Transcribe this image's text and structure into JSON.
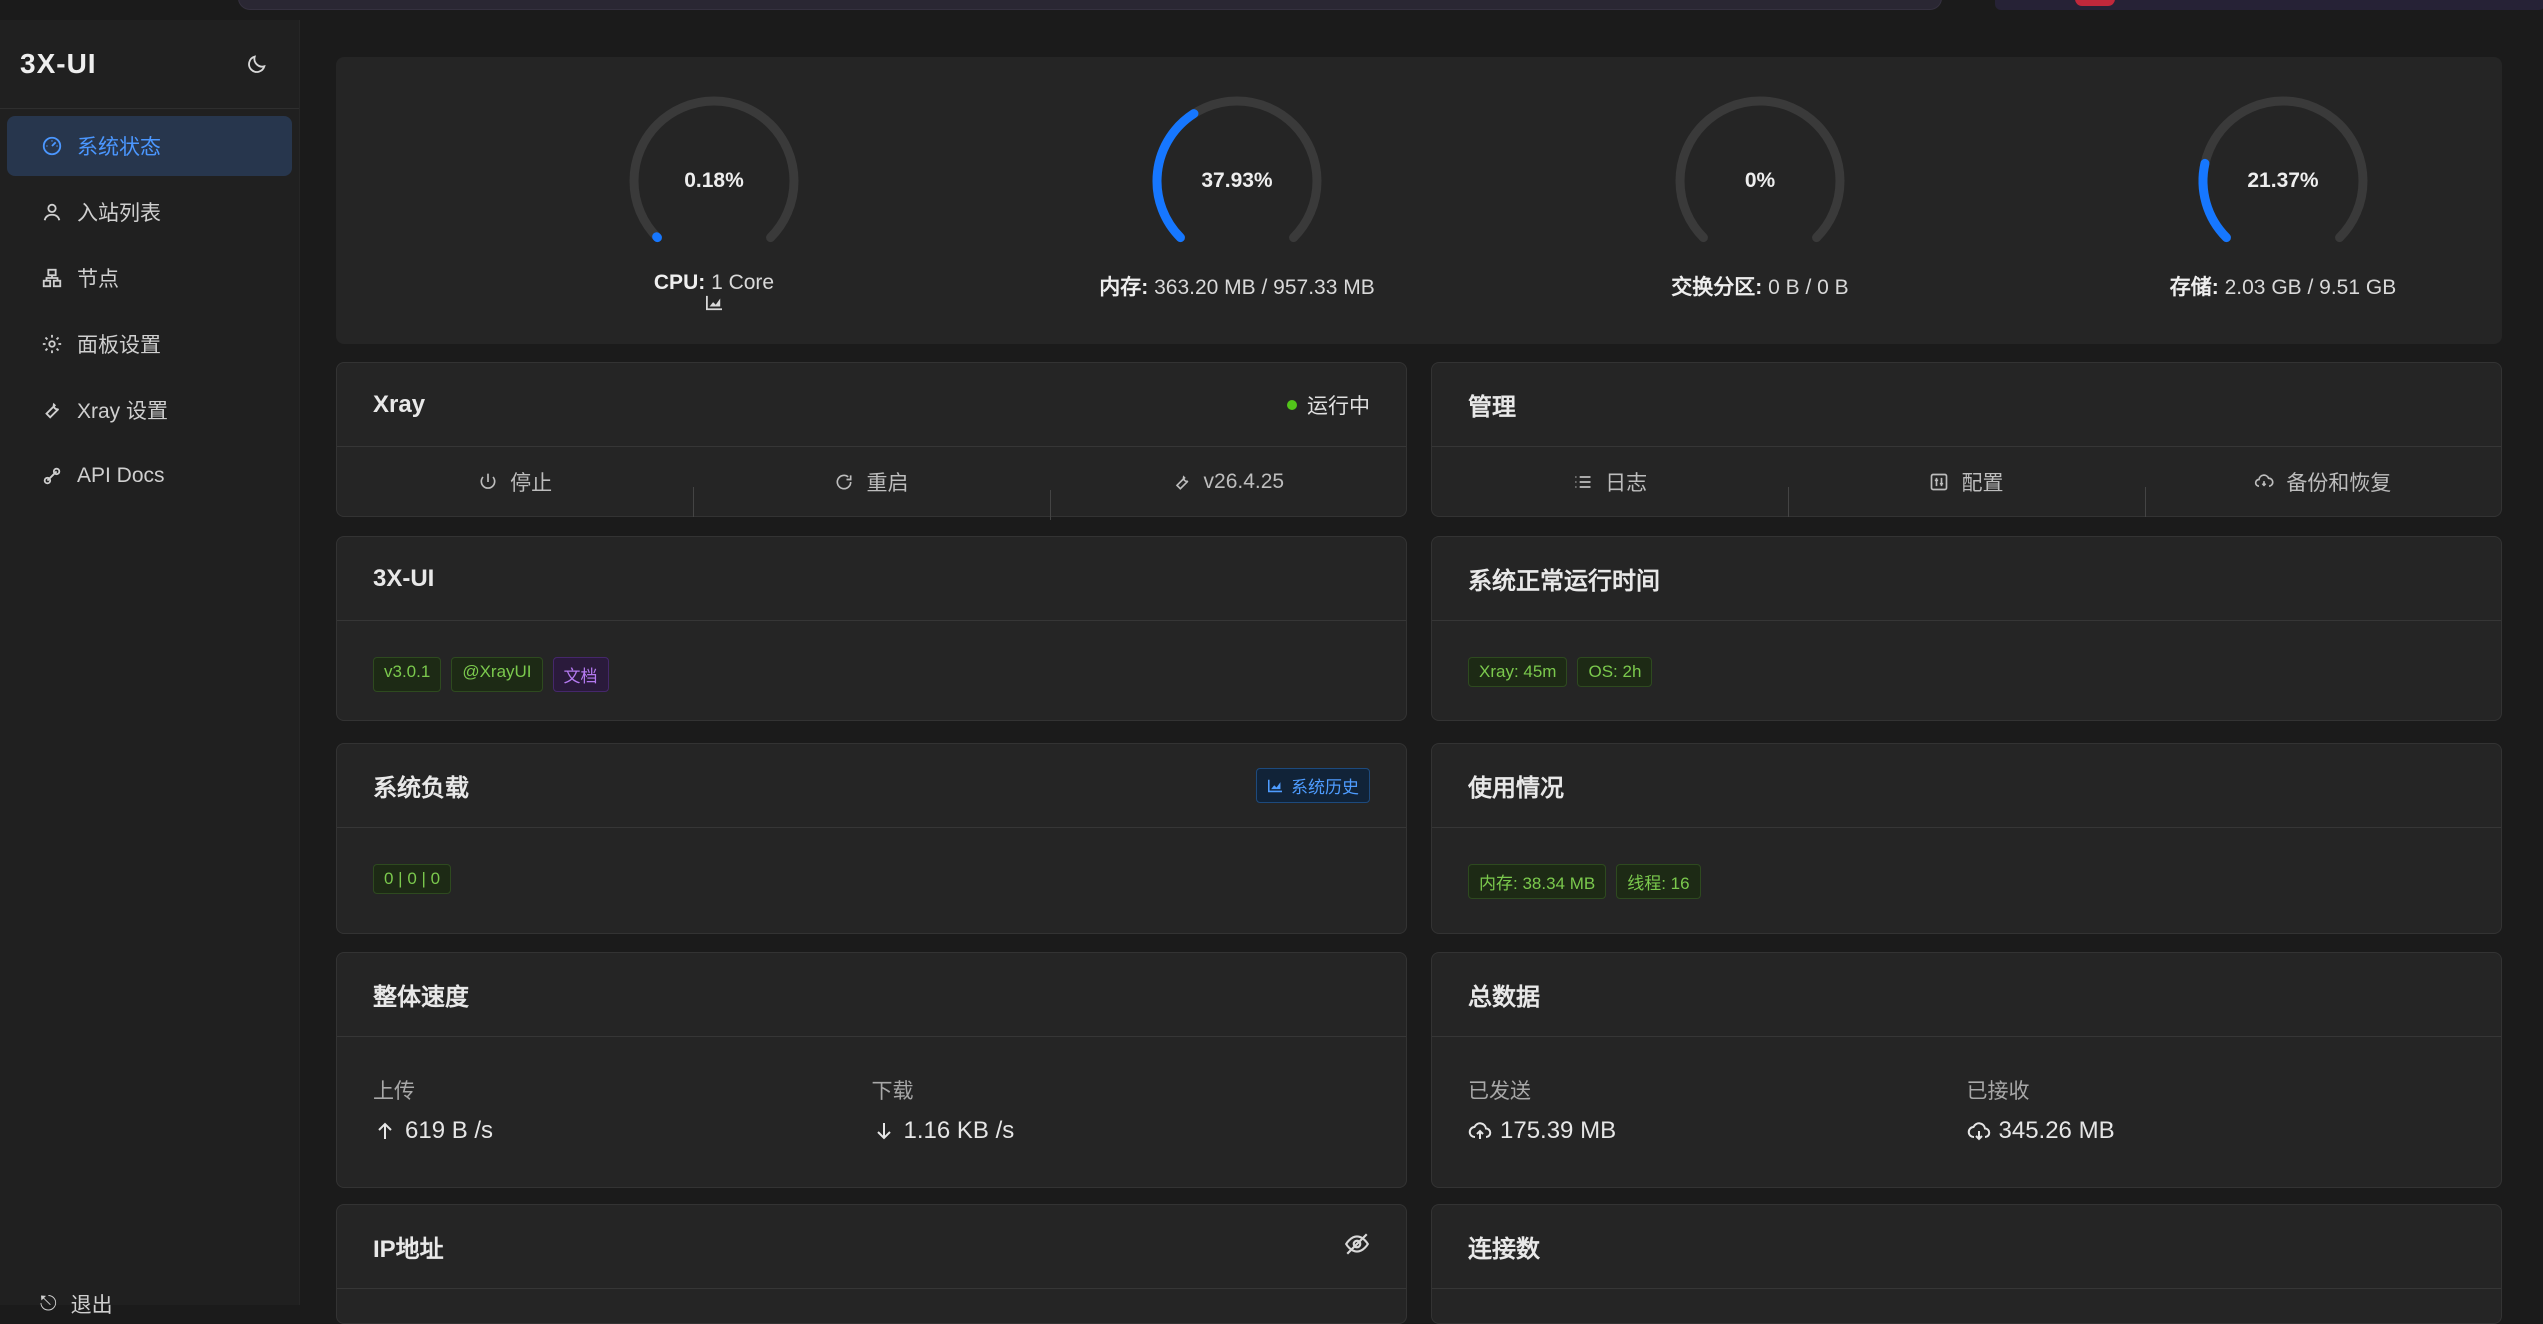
{
  "sidebar": {
    "brand": "3X-UI",
    "items": [
      {
        "label": "系统状态",
        "icon": "dashboard-icon",
        "active": true
      },
      {
        "label": "入站列表",
        "icon": "user-icon"
      },
      {
        "label": "节点",
        "icon": "cluster-icon"
      },
      {
        "label": "面板设置",
        "icon": "gear-icon"
      },
      {
        "label": "Xray 设置",
        "icon": "tool-icon"
      },
      {
        "label": "API Docs",
        "icon": "api-icon"
      }
    ],
    "logout": "退出"
  },
  "gauges": [
    {
      "percent": "0.18%",
      "value": 0.0018,
      "label_key": "CPU:",
      "label_value": "1 Core"
    },
    {
      "percent": "37.93%",
      "value": 0.3793,
      "label_key": "内存:",
      "label_value": "363.20 MB / 957.33 MB"
    },
    {
      "percent": "0%",
      "value": 0,
      "label_key": "交换分区:",
      "label_value": "0 B / 0 B"
    },
    {
      "percent": "21.37%",
      "value": 0.2137,
      "label_key": "存储:",
      "label_value": "2.03 GB / 9.51 GB"
    }
  ],
  "xray": {
    "title": "Xray",
    "status": "运行中",
    "actions": {
      "stop": "停止",
      "restart": "重启",
      "version": "v26.4.25"
    }
  },
  "manage": {
    "title": "管理",
    "actions": {
      "logs": "日志",
      "config": "配置",
      "backup": "备份和恢复"
    }
  },
  "panel": {
    "title": "3X-UI",
    "tags": [
      "v3.0.1",
      "@XrayUI",
      "文档"
    ]
  },
  "uptime": {
    "title": "系统正常运行时间",
    "tags": [
      "Xray: 45m",
      "OS: 2h"
    ]
  },
  "load": {
    "title": "系统负载",
    "history_button": "系统历史",
    "value": "0 | 0 | 0"
  },
  "usage": {
    "title": "使用情况",
    "tags": [
      "内存: 38.34 MB",
      "线程: 16"
    ]
  },
  "speed": {
    "title": "整体速度",
    "upload_label": "上传",
    "upload_value": "619 B /s",
    "download_label": "下载",
    "download_value": "1.16 KB /s"
  },
  "totals": {
    "title": "总数据",
    "sent_label": "已发送",
    "sent_value": "175.39 MB",
    "received_label": "已接收",
    "received_value": "345.26 MB"
  },
  "ip": {
    "title": "IP地址"
  },
  "connections": {
    "title": "连接数"
  },
  "colors": {
    "accent": "#1677ff",
    "success": "#52c41a",
    "track": "#3a3a3a"
  }
}
